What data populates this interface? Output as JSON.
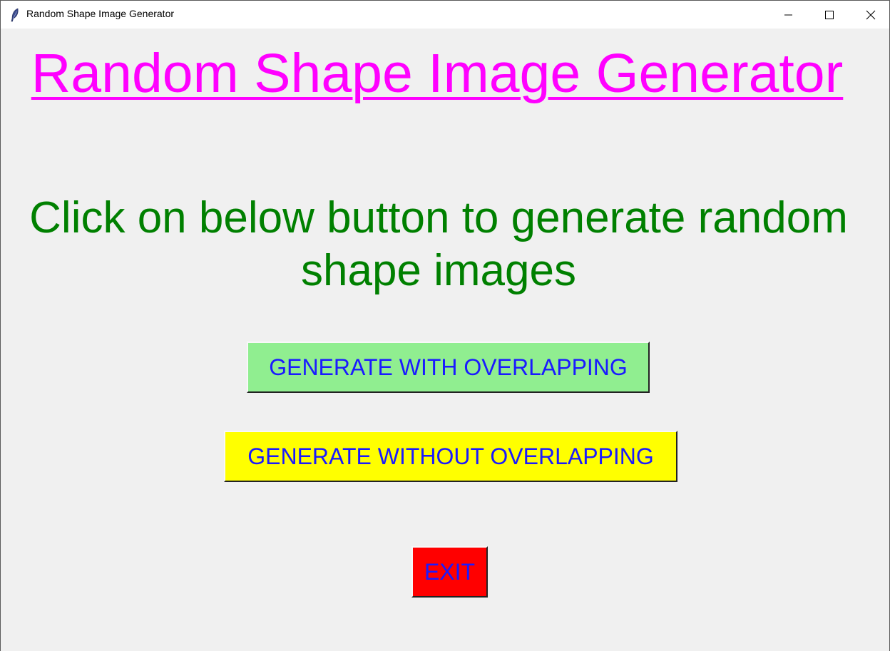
{
  "window": {
    "title": "Random Shape Image Generator",
    "app_icon": "feather-icon",
    "controls": {
      "minimize_icon": "minimize-icon",
      "maximize_icon": "maximize-icon",
      "close_icon": "close-icon"
    }
  },
  "main": {
    "heading": "Random Shape Image Generator",
    "subheading": "Click on below button to generate random shape images",
    "buttons": {
      "with_overlapping": "GENERATE WITH OVERLAPPING",
      "without_overlapping": "GENERATE WITHOUT OVERLAPPING",
      "exit": "EXIT"
    }
  },
  "colors": {
    "heading": "#ff00ff",
    "subheading": "#008000",
    "button_text": "#1a1aff",
    "with_overlapping_bg": "#90ee90",
    "without_overlapping_bg": "#ffff00",
    "exit_bg": "#ff0000",
    "background": "#f0f0f0"
  }
}
